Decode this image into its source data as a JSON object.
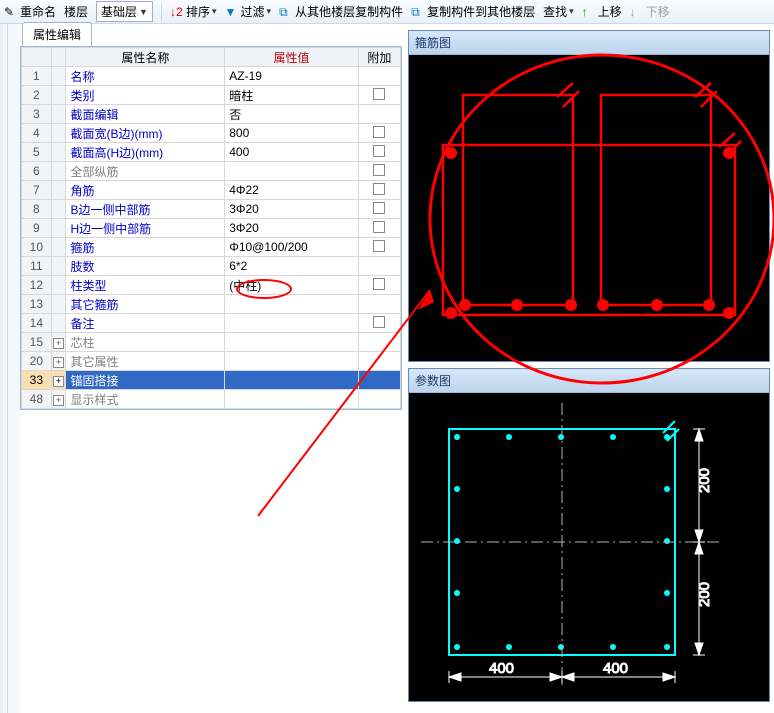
{
  "toolbar": {
    "rename": "重命名",
    "floor": "楼层",
    "base_layer": "基础层",
    "sort": "排序",
    "filter": "过滤",
    "copy_from": "从其他楼层复制构件",
    "copy_to": "复制构件到其他楼层",
    "find": "查找",
    "move_up": "上移",
    "move_down": "下移"
  },
  "tab_label": "属性编辑",
  "headers": {
    "name": "属性名称",
    "value": "属性值",
    "extra": "附加"
  },
  "rows": [
    {
      "n": "1",
      "name": "名称",
      "value": "AZ-19",
      "chk": false
    },
    {
      "n": "2",
      "name": "类别",
      "value": "暗柱",
      "chk": true
    },
    {
      "n": "3",
      "name": "截面编辑",
      "value": "否",
      "chk": false
    },
    {
      "n": "4",
      "name": "截面宽(B边)(mm)",
      "value": "800",
      "chk": true
    },
    {
      "n": "5",
      "name": "截面高(H边)(mm)",
      "value": "400",
      "chk": true
    },
    {
      "n": "6",
      "name": "全部纵筋",
      "value": "",
      "chk": true,
      "gray": true
    },
    {
      "n": "7",
      "name": "角筋",
      "value": "4Φ22",
      "chk": true
    },
    {
      "n": "8",
      "name": "B边一侧中部筋",
      "value": "3Φ20",
      "chk": true
    },
    {
      "n": "9",
      "name": "H边一侧中部筋",
      "value": "3Φ20",
      "chk": true
    },
    {
      "n": "10",
      "name": "箍筋",
      "value": "Φ10@100/200",
      "chk": true
    },
    {
      "n": "11",
      "name": "肢数",
      "value": "6*2",
      "chk": false
    },
    {
      "n": "12",
      "name": "柱类型",
      "value": "(中柱)",
      "chk": true
    },
    {
      "n": "13",
      "name": "其它箍筋",
      "value": "",
      "chk": false
    },
    {
      "n": "14",
      "name": "备注",
      "value": "",
      "chk": true
    },
    {
      "n": "15",
      "name": "芯柱",
      "value": "",
      "chk": false,
      "exp": true,
      "gray": true
    },
    {
      "n": "20",
      "name": "其它属性",
      "value": "",
      "chk": false,
      "exp": true,
      "gray": true
    },
    {
      "n": "33",
      "name": "锚固搭接",
      "value": "",
      "chk": false,
      "exp": true,
      "sel": true
    },
    {
      "n": "48",
      "name": "显示样式",
      "value": "",
      "chk": false,
      "exp": true,
      "gray": true
    }
  ],
  "panel1_title": "箍筋图",
  "panel2_title": "参数图",
  "chart_data": {
    "type": "diagram",
    "section": {
      "B_mm": 800,
      "H_mm": 400
    },
    "param_labels": {
      "top_half": "200",
      "bottom_half": "200",
      "left_half": "400",
      "right_half": "400"
    }
  }
}
